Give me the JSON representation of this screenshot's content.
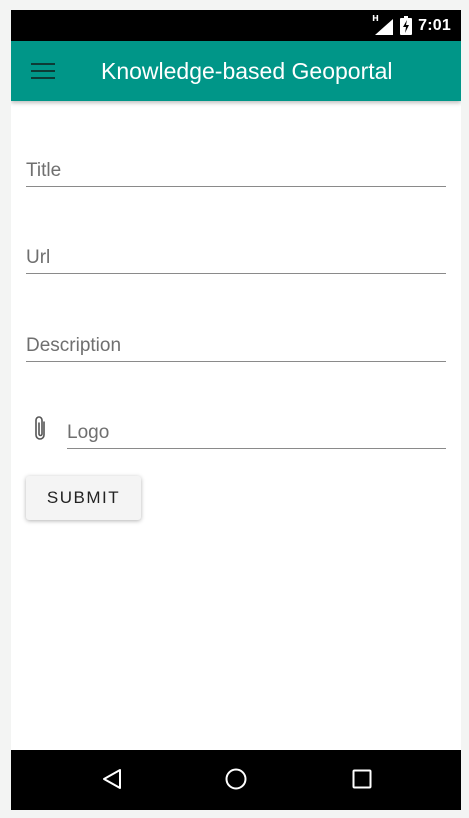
{
  "status_bar": {
    "network_label": "H",
    "time": "7:01",
    "icons": [
      "signal-icon",
      "battery-charging-icon"
    ]
  },
  "app_bar": {
    "menu_icon": "hamburger-menu-icon",
    "title": "Knowledge-based Geoportal",
    "background_color": "#009688"
  },
  "form": {
    "title_placeholder": "Title",
    "url_placeholder": "Url",
    "description_placeholder": "Description",
    "logo_placeholder": "Logo",
    "logo_icon": "paperclip-icon",
    "submit_label": "SUBMIT"
  },
  "nav_bar": {
    "icons": [
      "back-icon",
      "home-icon",
      "recents-icon"
    ]
  }
}
